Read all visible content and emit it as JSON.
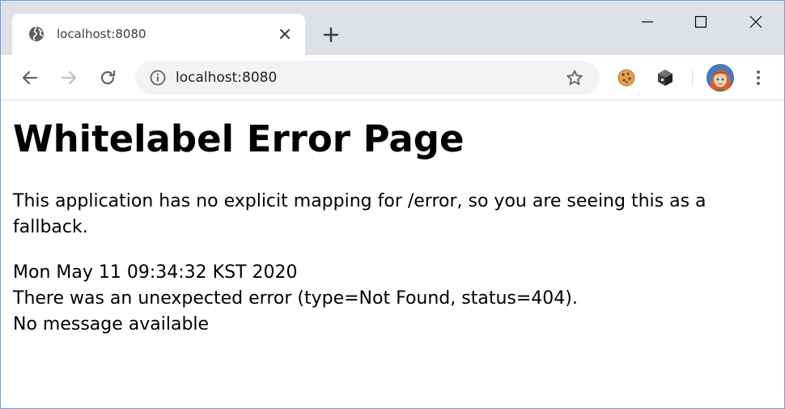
{
  "browser": {
    "tab": {
      "favicon": "globe-icon",
      "title": "localhost:8080",
      "close_icon": "close-icon"
    },
    "new_tab_icon": "plus-icon",
    "window_controls": [
      "minimize-icon",
      "maximize-icon",
      "close-icon"
    ],
    "toolbar": {
      "back_icon": "arrow-left-icon",
      "forward_icon": "arrow-right-icon",
      "reload_icon": "reload-icon",
      "address": {
        "info_icon": "info-icon",
        "url": "localhost:8080",
        "bookmark_icon": "star-icon"
      },
      "extensions": [
        "cookie-icon",
        "cube-icon"
      ],
      "profile_icon": "avatar",
      "menu_icon": "more-vert-icon"
    },
    "colors": {
      "tabstrip": "#dee1e6",
      "omnibox": "#f1f3f4",
      "icon": "#5f6368",
      "icon_disabled": "#bdc1c6"
    }
  },
  "page": {
    "heading": "Whitelabel Error Page",
    "lead": "This application has no explicit mapping for /error, so you are seeing this as a fallback.",
    "timestamp": "Mon May 11 09:34:32 KST 2020",
    "error_line": "There was an unexpected error (type=Not Found, status=404).",
    "message": "No message available"
  }
}
